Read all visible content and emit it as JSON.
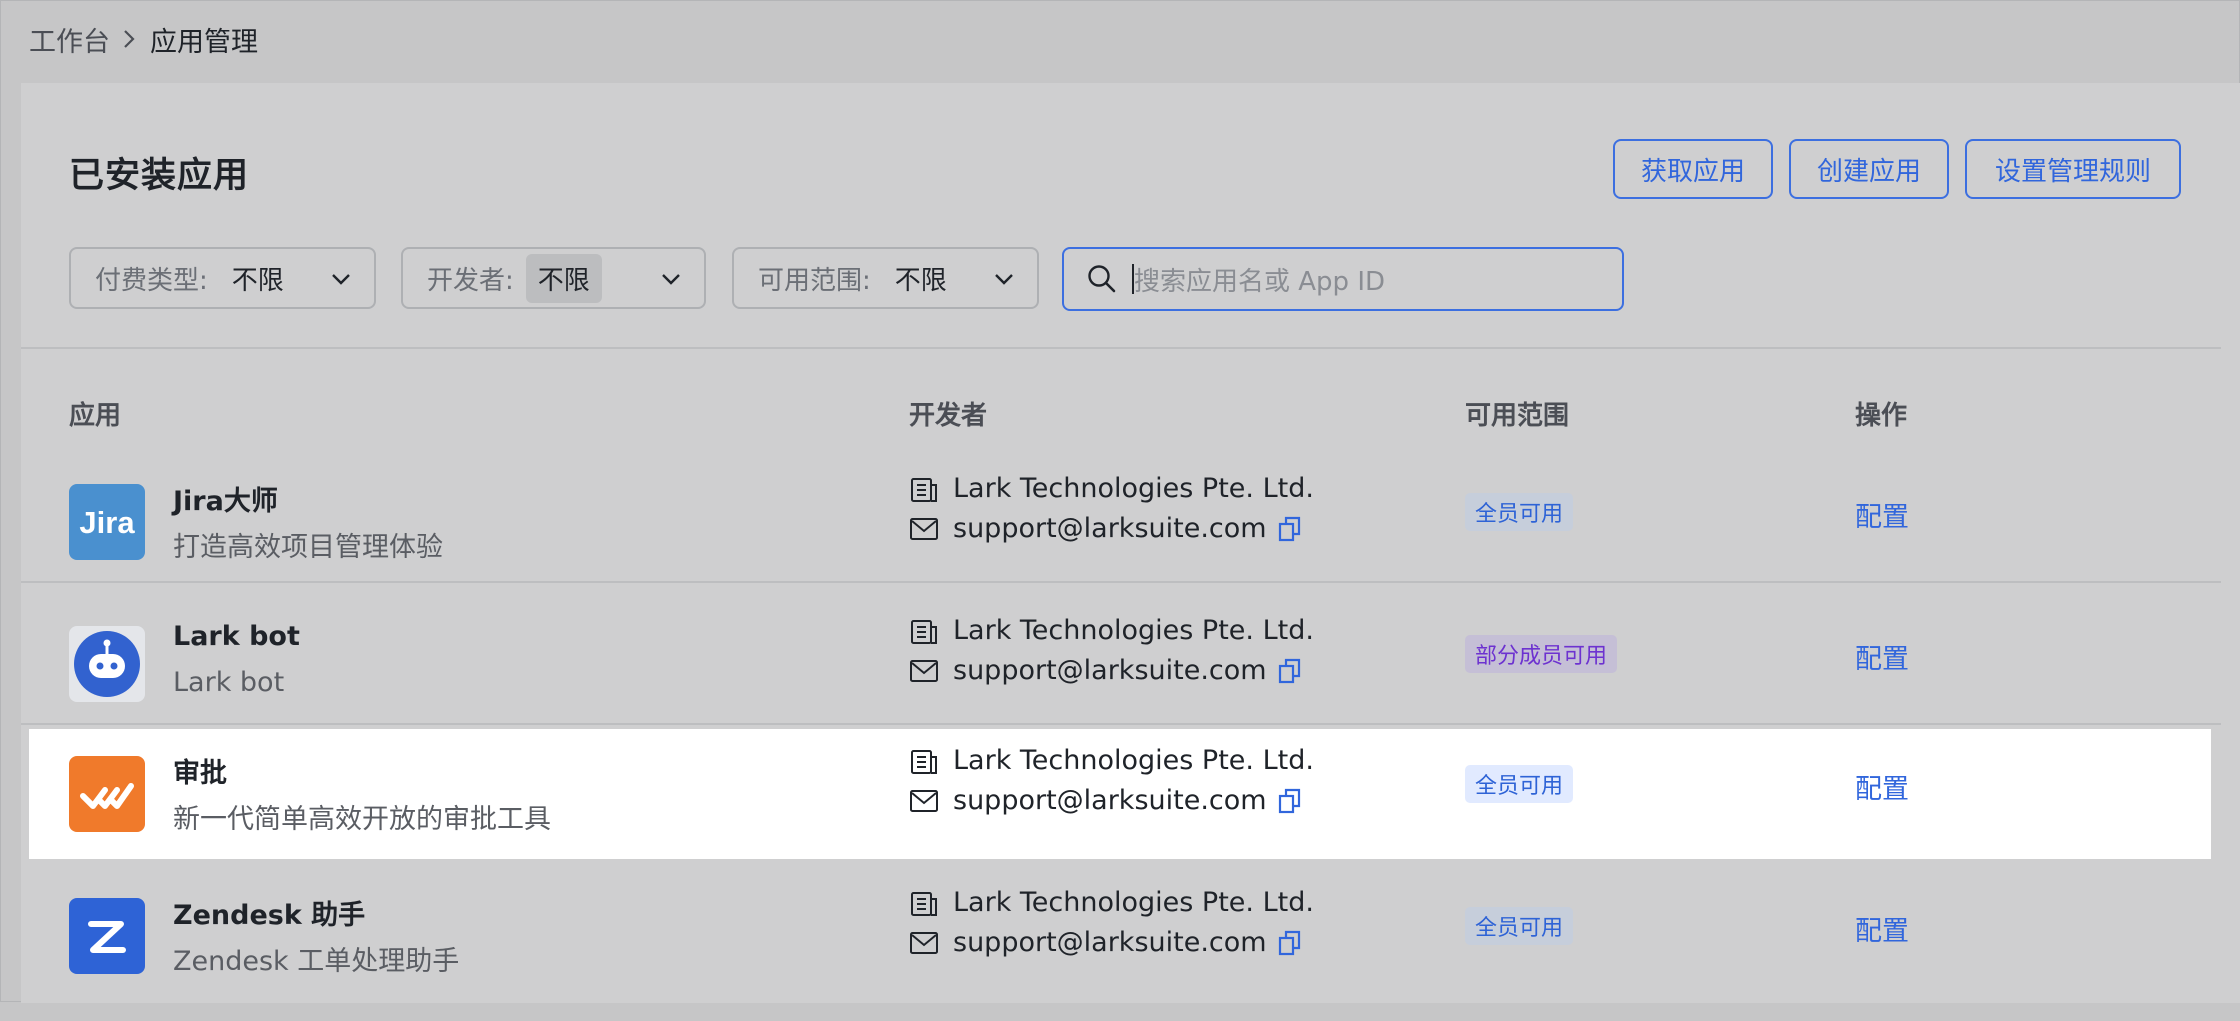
{
  "breadcrumb": {
    "root": "工作台",
    "current": "应用管理"
  },
  "page": {
    "title": "已安装应用"
  },
  "toolbar": {
    "get_app": "获取应用",
    "create_app": "创建应用",
    "rules": "设置管理规则"
  },
  "filters": {
    "pay": {
      "label": "付费类型:",
      "value": "不限"
    },
    "developer": {
      "label": "开发者:",
      "value": "不限"
    },
    "scope": {
      "label": "可用范围:",
      "value": "不限"
    }
  },
  "search": {
    "placeholder": "搜索应用名或 App ID",
    "icon": "search-icon"
  },
  "table": {
    "headers": {
      "app": "应用",
      "developer": "开发者",
      "scope": "可用范围",
      "action": "操作"
    },
    "rows": [
      {
        "name": "Jira大师",
        "desc": "打造高效项目管理体验",
        "company": "Lark Technologies Pte. Ltd.",
        "email": "support@larksuite.com",
        "scope": "全员可用",
        "action": "配置",
        "logo": "jira-logo",
        "logo_color": "#4a90cf"
      },
      {
        "name": "Lark bot",
        "desc": "Lark bot",
        "company": "Lark Technologies Pte. Ltd.",
        "email": "support@larksuite.com",
        "scope": "部分成员可用",
        "action": "配置",
        "logo": "robot-logo",
        "logo_color": "#3262cf"
      },
      {
        "name": "审批",
        "desc": "新一代简单高效开放的审批工具",
        "company": "Lark Technologies Pte. Ltd.",
        "email": "support@larksuite.com",
        "scope": "全员可用",
        "action": "配置",
        "logo": "approval-logo",
        "logo_color": "#f07a2b"
      },
      {
        "name": "Zendesk 助手",
        "desc": "Zendesk 工单处理助手",
        "company": "Lark Technologies Pte. Ltd.",
        "email": "support@larksuite.com",
        "scope": "全员可用",
        "action": "配置",
        "logo": "zendesk-logo",
        "logo_color": "#2e63d6"
      }
    ]
  },
  "colors": {
    "accent": "#3166dc",
    "highlight_row": "#ffffff",
    "overlay": "#c6c6c7"
  }
}
